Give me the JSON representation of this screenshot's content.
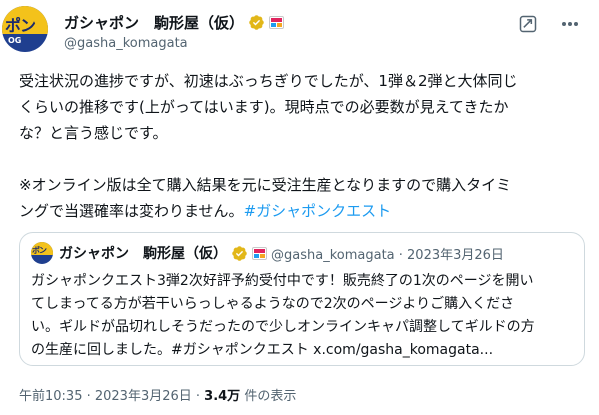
{
  "author": {
    "display_name": "ガシャポン　駒形屋（仮）",
    "handle": "@gasha_komagata",
    "avatar_text": "ポン",
    "avatar_sub": "OG"
  },
  "tweet": {
    "lines": [
      "受注状況の進捗ですが、初速はぶっちぎりでしたが、1弾＆2弾と大体同じ",
      "くらいの推移です(上がってはいます)。現時点での必要数が見えてきたか",
      "な？と言う感じです。",
      "",
      "※オンライン版は全て購入結果を元に受注生産となりますので購入タイミ"
    ],
    "last_line_text": "ングで当選確率は変わりません。",
    "hashtag": "#ガシャポンクエスト"
  },
  "quote": {
    "display_name": "ガシャポン　駒形屋（仮）",
    "handle_date": "@gasha_komagata · 2023年3月26日",
    "avatar_text": "ポン",
    "lines": [
      "ガシャポンクエスト3弾2次好評予約受付中です！販売終了の1次のページを開い",
      "てしまってる方が若干いらっしゃるようなので2次のページよりご購入くださ",
      "い。ギルドが品切れしそうだったので少しオンラインキャパ調整してギルドの方",
      "の生産に回しました。#ガシャポンクエスト x.com/gasha_komagata..."
    ]
  },
  "meta": {
    "time_date": "午前10:35 · 2023年3月26日 · ",
    "views_count": "3.4万",
    "views_label": " 件の表示"
  },
  "colors": {
    "accent": "#1d9bf0",
    "verified_gold": "#e2b719",
    "secondary_text": "#536471",
    "border": "#cfd9de"
  },
  "icons": [
    "verified-badge-icon",
    "affiliate-badge-icon",
    "grok-icon",
    "more-icon"
  ]
}
